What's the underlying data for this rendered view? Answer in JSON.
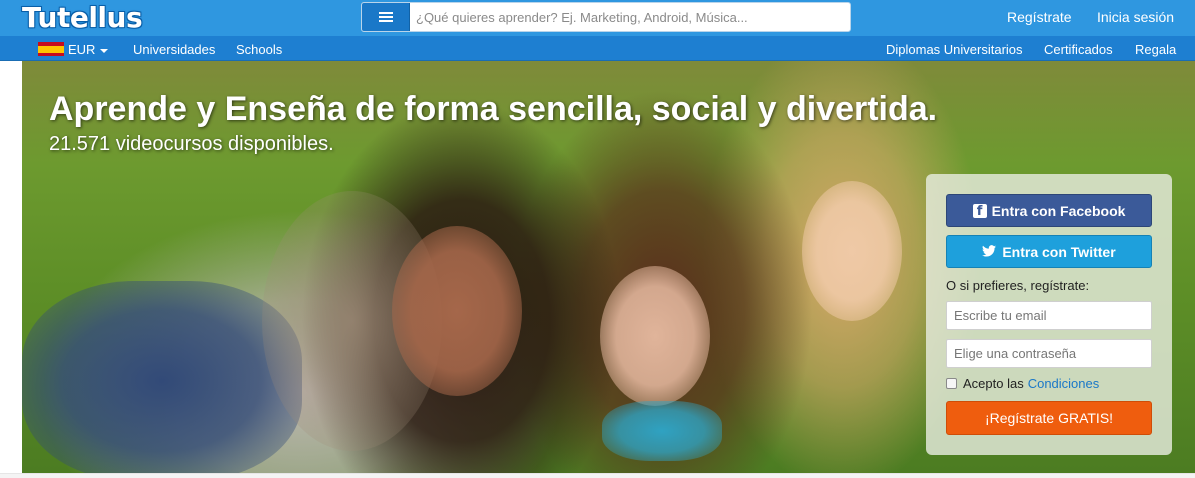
{
  "header": {
    "logo": "Tutellus",
    "search_placeholder": "¿Qué quieres aprender? Ej. Marketing, Android, Música...",
    "register_link": "Regístrate",
    "login_link": "Inicia sesión"
  },
  "subnav": {
    "currency": "EUR",
    "left_items": [
      "Universidades",
      "Schools"
    ],
    "right_items": [
      "Diplomas Universitarios",
      "Certificados",
      "Regala"
    ]
  },
  "hero": {
    "title": "Aprende y Enseña de forma sencilla, social y divertida.",
    "subtitle": "21.571 videocursos disponibles."
  },
  "signup": {
    "facebook_button": "Entra con Facebook",
    "twitter_button": "Entra con Twitter",
    "or_text": "O si prefieres, regístrate:",
    "email_placeholder": "Escribe tu email",
    "password_placeholder": "Elige una contraseña",
    "accept_text": "Acepto las",
    "conditions_link": "Condiciones",
    "submit_button": "¡Regístrate GRATIS!"
  },
  "colors": {
    "header_blue": "#2f97e0",
    "subnav_blue": "#1e7fd1",
    "facebook": "#3b5a99",
    "twitter": "#1ea0dc",
    "cta_orange": "#ef5d0e"
  },
  "icons": {
    "menu": "hamburger-icon",
    "flag": "spain-flag-icon",
    "facebook": "facebook-icon",
    "twitter": "twitter-bird-icon"
  }
}
